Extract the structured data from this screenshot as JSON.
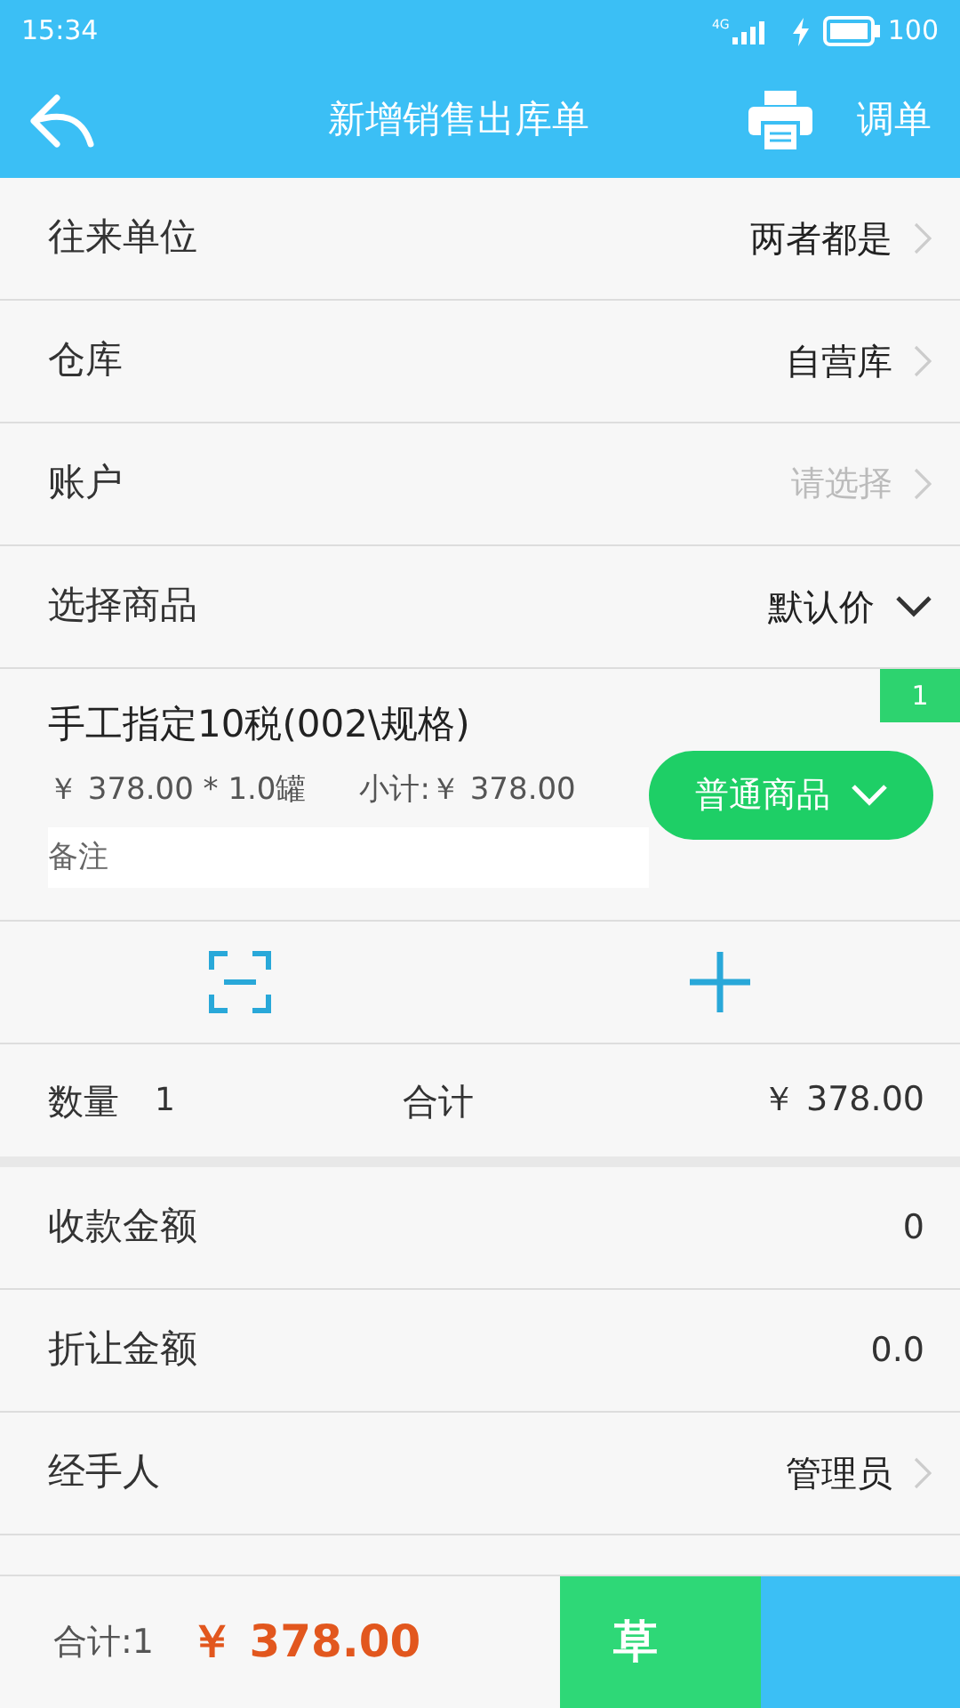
{
  "status_bar": {
    "time": "15:34",
    "network": "4G",
    "battery": "100"
  },
  "header": {
    "title": "新增销售出库单",
    "action": "调单"
  },
  "fields": [
    {
      "label": "往来单位",
      "value": "两者都是",
      "kind": "nav"
    },
    {
      "label": "仓库",
      "value": "自营库",
      "kind": "nav"
    },
    {
      "label": "账户",
      "placeholder": "请选择",
      "kind": "nav"
    },
    {
      "label": "选择商品",
      "value": "默认价",
      "kind": "dropdown"
    }
  ],
  "product": {
    "index": "1",
    "name": "手工指定10税(002\\规格)",
    "price_line": "￥ 378.00 * 1.0罐",
    "subtotal": "小计:￥ 378.00",
    "note_placeholder": "备注",
    "type_button": "普通商品"
  },
  "summary": {
    "qty_label": "数量",
    "qty": "1",
    "total_label": "合计",
    "total": "￥ 378.00"
  },
  "details": [
    {
      "label": "收款金额",
      "value": "0",
      "kind": "input"
    },
    {
      "label": "折让金额",
      "value": "0.0",
      "kind": "input"
    },
    {
      "label": "经手人",
      "value": "管理员",
      "kind": "nav"
    }
  ],
  "footer": {
    "total_label": "合计:1",
    "amount": "￥ 378.00",
    "buttons": [
      {
        "kind": "draft",
        "label": "草"
      },
      {
        "kind": "submit"
      }
    ]
  }
}
